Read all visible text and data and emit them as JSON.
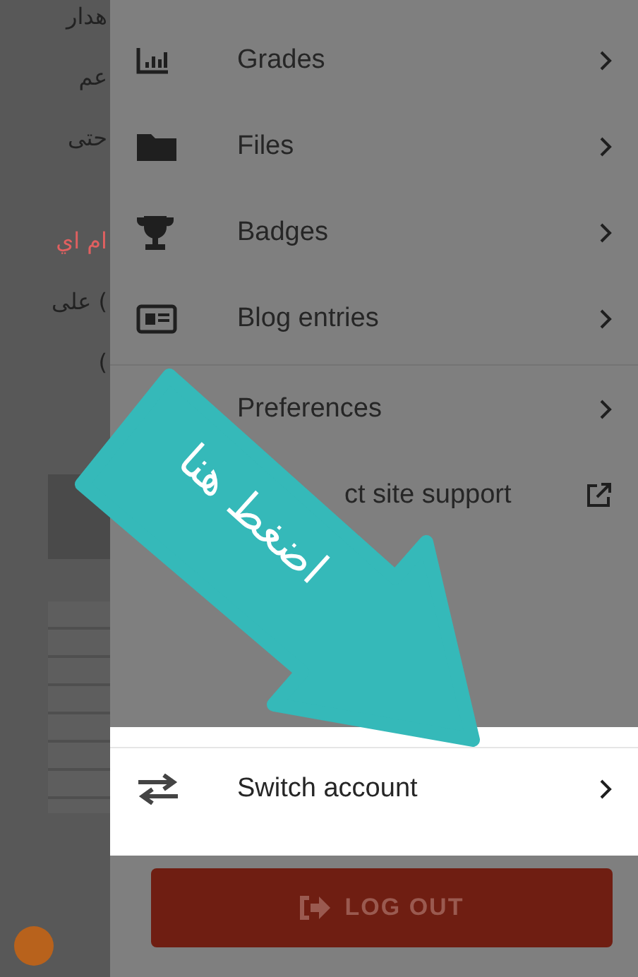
{
  "background_page": {
    "text_fragments": [
      {
        "text": "هدار",
        "kind": "plain"
      },
      {
        "text": "عم",
        "kind": "plain"
      },
      {
        "text": "حتى",
        "kind": "plain"
      },
      {
        "text": "ام اي",
        "kind": "link"
      },
      {
        "text": "على (",
        "kind": "plain"
      },
      {
        "text": "(",
        "kind": "plain"
      }
    ]
  },
  "menu": {
    "sections": [
      [
        {
          "kind": "grades",
          "label": "Grades",
          "external": false
        },
        {
          "kind": "files",
          "label": "Files",
          "external": false
        },
        {
          "kind": "badges",
          "label": "Badges",
          "external": false
        },
        {
          "kind": "blog",
          "label": "Blog entries",
          "external": false
        }
      ],
      [
        {
          "kind": "preferences",
          "label": "Preferences",
          "external": false
        },
        {
          "kind": "support",
          "label": "ct site support",
          "external": true
        }
      ]
    ],
    "switch_account": {
      "label": "Switch account",
      "selected": true
    },
    "logout": {
      "label": "LOG OUT"
    }
  },
  "annotation": {
    "text": "اضغط هنا"
  }
}
